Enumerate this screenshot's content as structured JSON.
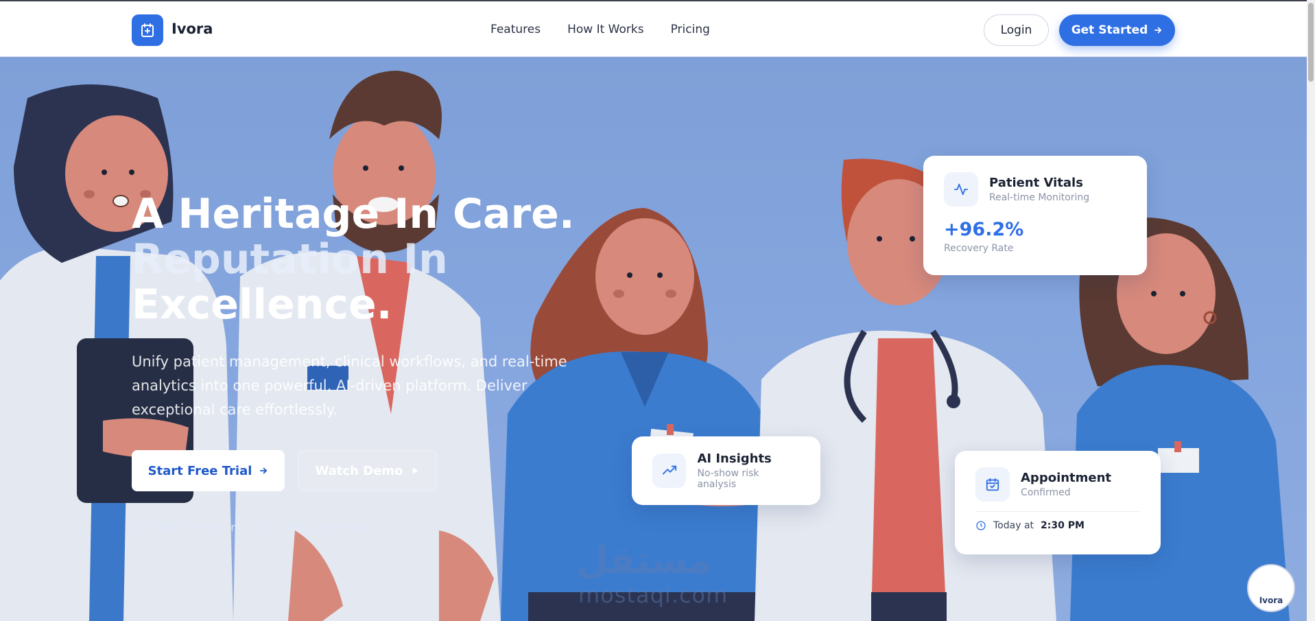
{
  "nav": {
    "brand": "Ivora",
    "links": [
      "Features",
      "How It Works",
      "Pricing"
    ],
    "login": "Login",
    "get_started": "Get Started"
  },
  "hero": {
    "headline_1": "A Heritage In Care.",
    "headline_2": "Reputation In",
    "headline_3": "Excellence.",
    "subtitle": "Unify patient management, clinical workflows, and real-time analytics into one powerful, AI-driven platform. Deliver exceptional care effortlessly.",
    "cta_primary": "Start Free Trial",
    "cta_secondary": "Watch Demo",
    "badges": [
      "HIPAA Compliant",
      "14-day free trial"
    ]
  },
  "cards": {
    "vitals": {
      "title": "Patient Vitals",
      "subtitle": "Real-time Monitoring",
      "value": "+96.2%",
      "value_label": "Recovery Rate"
    },
    "ai": {
      "title": "AI Insights",
      "subtitle": "No-show risk analysis"
    },
    "appointment": {
      "title": "Appointment",
      "subtitle": "Confirmed",
      "time_prefix": "Today at",
      "time": "2:30 PM"
    }
  },
  "watermark": {
    "arabic": "مستقل",
    "latin": "mostaql.com",
    "seal": "Ivora"
  },
  "colors": {
    "accent": "#2f6fe4",
    "hero_bg": "#7f9fd8",
    "text_dark": "#1b2233"
  },
  "icons": [
    "calendar-plus-icon",
    "arrow-right-icon",
    "play-icon",
    "shield-check-icon",
    "activity-icon",
    "trending-up-icon",
    "calendar-check-icon",
    "clock-icon"
  ]
}
